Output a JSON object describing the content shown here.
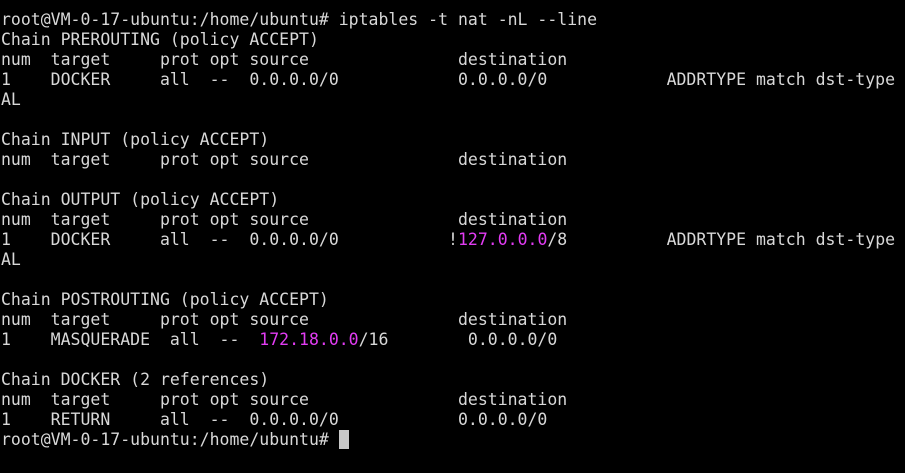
{
  "colors": {
    "background": "#000000",
    "text": "#d8d8d8",
    "highlight": "#e23cf3",
    "cursor": "#c8c8c8"
  },
  "terminal": {
    "lines": [
      {
        "segments": [
          {
            "text": "root@VM-0-17-ubuntu:/home/ubuntu# iptables -t nat -nL --line"
          }
        ]
      },
      {
        "segments": [
          {
            "text": "Chain PREROUTING (policy ACCEPT)"
          }
        ]
      },
      {
        "segments": [
          {
            "text": "num  target     prot opt source               destination"
          }
        ]
      },
      {
        "segments": [
          {
            "text": "1    DOCKER     all  --  0.0.0.0/0            0.0.0.0/0            ADDRTYPE match dst-type"
          }
        ]
      },
      {
        "segments": [
          {
            "text": "AL"
          }
        ]
      },
      {
        "segments": []
      },
      {
        "segments": [
          {
            "text": "Chain INPUT (policy ACCEPT)"
          }
        ]
      },
      {
        "segments": [
          {
            "text": "num  target     prot opt source               destination"
          }
        ]
      },
      {
        "segments": []
      },
      {
        "segments": [
          {
            "text": "Chain OUTPUT (policy ACCEPT)"
          }
        ]
      },
      {
        "segments": [
          {
            "text": "num  target     prot opt source               destination"
          }
        ]
      },
      {
        "segments": [
          {
            "text": "1    DOCKER     all  --  0.0.0.0/0           !"
          },
          {
            "text": "127.0.0.0",
            "highlight": true
          },
          {
            "text": "/8          ADDRTYPE match dst-type"
          }
        ]
      },
      {
        "segments": [
          {
            "text": "AL"
          }
        ]
      },
      {
        "segments": []
      },
      {
        "segments": [
          {
            "text": "Chain POSTROUTING (policy ACCEPT)"
          }
        ]
      },
      {
        "segments": [
          {
            "text": "num  target     prot opt source               destination"
          }
        ]
      },
      {
        "segments": [
          {
            "text": "1    MASQUERADE  all  --  "
          },
          {
            "text": "172.18.0.0",
            "highlight": true
          },
          {
            "text": "/16        0.0.0.0/0"
          }
        ]
      },
      {
        "segments": []
      },
      {
        "segments": [
          {
            "text": "Chain DOCKER (2 references)"
          }
        ]
      },
      {
        "segments": [
          {
            "text": "num  target     prot opt source               destination"
          }
        ]
      },
      {
        "segments": [
          {
            "text": "1    RETURN     all  --  0.0.0.0/0            0.0.0.0/0"
          }
        ]
      },
      {
        "segments": [
          {
            "text": "root@VM-0-17-ubuntu:/home/ubuntu# "
          }
        ],
        "cursor": true
      }
    ]
  }
}
